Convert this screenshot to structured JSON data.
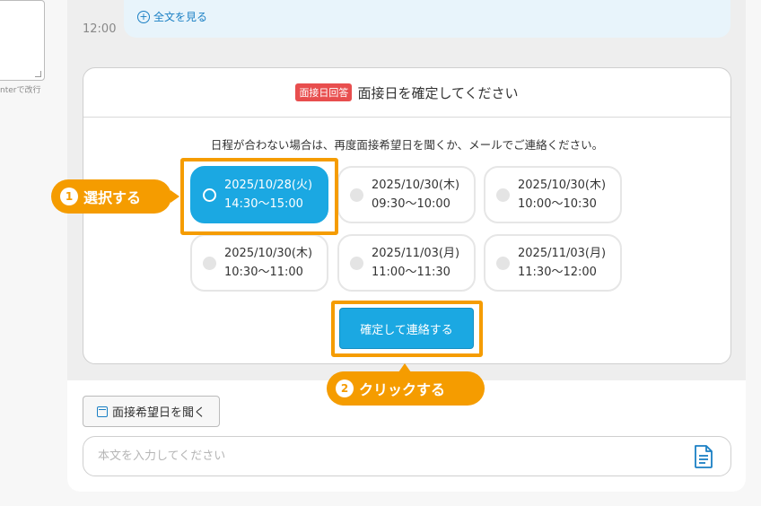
{
  "left": {
    "hint": "nterで改行"
  },
  "timeline": {
    "time": "12:00",
    "show_full": "全文を見る"
  },
  "card": {
    "badge": "面接日回答",
    "title": "面接日を確定してください",
    "note": "日程が合わない場合は、再度面接希望日を聞くか、メールでご連絡ください。",
    "slots": [
      {
        "date": "2025/10/28(火)",
        "time": "14:30〜15:00",
        "selected": true
      },
      {
        "date": "2025/10/30(木)",
        "time": "09:30〜10:00",
        "selected": false
      },
      {
        "date": "2025/10/30(木)",
        "time": "10:00〜10:30",
        "selected": false
      },
      {
        "date": "2025/10/30(木)",
        "time": "10:30〜11:00",
        "selected": false
      },
      {
        "date": "2025/11/03(月)",
        "time": "11:00〜11:30",
        "selected": false
      },
      {
        "date": "2025/11/03(月)",
        "time": "11:30〜12:00",
        "selected": false
      }
    ],
    "confirm_label": "確定して連絡する"
  },
  "callouts": {
    "step1": {
      "num": "1",
      "text": "選択する"
    },
    "step2": {
      "num": "2",
      "text": "クリックする"
    }
  },
  "composer": {
    "ask_label": "面接希望日を聞く",
    "placeholder": "本文を入力してください"
  },
  "colors": {
    "accent": "#1ba8e2",
    "highlight": "#f59c00",
    "badge": "#e84e4e",
    "link": "#1a7fc4"
  }
}
